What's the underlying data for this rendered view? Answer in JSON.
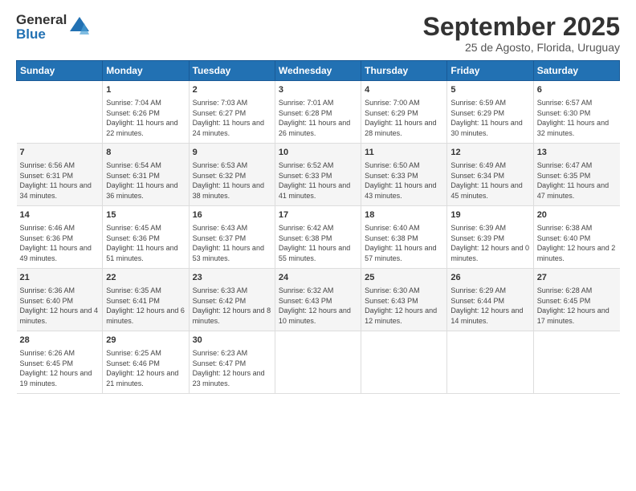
{
  "logo": {
    "line1": "General",
    "line2": "Blue"
  },
  "title": "September 2025",
  "subtitle": "25 de Agosto, Florida, Uruguay",
  "weekdays": [
    "Sunday",
    "Monday",
    "Tuesday",
    "Wednesday",
    "Thursday",
    "Friday",
    "Saturday"
  ],
  "weeks": [
    [
      {
        "day": "",
        "sunrise": "",
        "sunset": "",
        "daylight": ""
      },
      {
        "day": "1",
        "sunrise": "Sunrise: 7:04 AM",
        "sunset": "Sunset: 6:26 PM",
        "daylight": "Daylight: 11 hours and 22 minutes."
      },
      {
        "day": "2",
        "sunrise": "Sunrise: 7:03 AM",
        "sunset": "Sunset: 6:27 PM",
        "daylight": "Daylight: 11 hours and 24 minutes."
      },
      {
        "day": "3",
        "sunrise": "Sunrise: 7:01 AM",
        "sunset": "Sunset: 6:28 PM",
        "daylight": "Daylight: 11 hours and 26 minutes."
      },
      {
        "day": "4",
        "sunrise": "Sunrise: 7:00 AM",
        "sunset": "Sunset: 6:29 PM",
        "daylight": "Daylight: 11 hours and 28 minutes."
      },
      {
        "day": "5",
        "sunrise": "Sunrise: 6:59 AM",
        "sunset": "Sunset: 6:29 PM",
        "daylight": "Daylight: 11 hours and 30 minutes."
      },
      {
        "day": "6",
        "sunrise": "Sunrise: 6:57 AM",
        "sunset": "Sunset: 6:30 PM",
        "daylight": "Daylight: 11 hours and 32 minutes."
      }
    ],
    [
      {
        "day": "7",
        "sunrise": "Sunrise: 6:56 AM",
        "sunset": "Sunset: 6:31 PM",
        "daylight": "Daylight: 11 hours and 34 minutes."
      },
      {
        "day": "8",
        "sunrise": "Sunrise: 6:54 AM",
        "sunset": "Sunset: 6:31 PM",
        "daylight": "Daylight: 11 hours and 36 minutes."
      },
      {
        "day": "9",
        "sunrise": "Sunrise: 6:53 AM",
        "sunset": "Sunset: 6:32 PM",
        "daylight": "Daylight: 11 hours and 38 minutes."
      },
      {
        "day": "10",
        "sunrise": "Sunrise: 6:52 AM",
        "sunset": "Sunset: 6:33 PM",
        "daylight": "Daylight: 11 hours and 41 minutes."
      },
      {
        "day": "11",
        "sunrise": "Sunrise: 6:50 AM",
        "sunset": "Sunset: 6:33 PM",
        "daylight": "Daylight: 11 hours and 43 minutes."
      },
      {
        "day": "12",
        "sunrise": "Sunrise: 6:49 AM",
        "sunset": "Sunset: 6:34 PM",
        "daylight": "Daylight: 11 hours and 45 minutes."
      },
      {
        "day": "13",
        "sunrise": "Sunrise: 6:47 AM",
        "sunset": "Sunset: 6:35 PM",
        "daylight": "Daylight: 11 hours and 47 minutes."
      }
    ],
    [
      {
        "day": "14",
        "sunrise": "Sunrise: 6:46 AM",
        "sunset": "Sunset: 6:36 PM",
        "daylight": "Daylight: 11 hours and 49 minutes."
      },
      {
        "day": "15",
        "sunrise": "Sunrise: 6:45 AM",
        "sunset": "Sunset: 6:36 PM",
        "daylight": "Daylight: 11 hours and 51 minutes."
      },
      {
        "day": "16",
        "sunrise": "Sunrise: 6:43 AM",
        "sunset": "Sunset: 6:37 PM",
        "daylight": "Daylight: 11 hours and 53 minutes."
      },
      {
        "day": "17",
        "sunrise": "Sunrise: 6:42 AM",
        "sunset": "Sunset: 6:38 PM",
        "daylight": "Daylight: 11 hours and 55 minutes."
      },
      {
        "day": "18",
        "sunrise": "Sunrise: 6:40 AM",
        "sunset": "Sunset: 6:38 PM",
        "daylight": "Daylight: 11 hours and 57 minutes."
      },
      {
        "day": "19",
        "sunrise": "Sunrise: 6:39 AM",
        "sunset": "Sunset: 6:39 PM",
        "daylight": "Daylight: 12 hours and 0 minutes."
      },
      {
        "day": "20",
        "sunrise": "Sunrise: 6:38 AM",
        "sunset": "Sunset: 6:40 PM",
        "daylight": "Daylight: 12 hours and 2 minutes."
      }
    ],
    [
      {
        "day": "21",
        "sunrise": "Sunrise: 6:36 AM",
        "sunset": "Sunset: 6:40 PM",
        "daylight": "Daylight: 12 hours and 4 minutes."
      },
      {
        "day": "22",
        "sunrise": "Sunrise: 6:35 AM",
        "sunset": "Sunset: 6:41 PM",
        "daylight": "Daylight: 12 hours and 6 minutes."
      },
      {
        "day": "23",
        "sunrise": "Sunrise: 6:33 AM",
        "sunset": "Sunset: 6:42 PM",
        "daylight": "Daylight: 12 hours and 8 minutes."
      },
      {
        "day": "24",
        "sunrise": "Sunrise: 6:32 AM",
        "sunset": "Sunset: 6:43 PM",
        "daylight": "Daylight: 12 hours and 10 minutes."
      },
      {
        "day": "25",
        "sunrise": "Sunrise: 6:30 AM",
        "sunset": "Sunset: 6:43 PM",
        "daylight": "Daylight: 12 hours and 12 minutes."
      },
      {
        "day": "26",
        "sunrise": "Sunrise: 6:29 AM",
        "sunset": "Sunset: 6:44 PM",
        "daylight": "Daylight: 12 hours and 14 minutes."
      },
      {
        "day": "27",
        "sunrise": "Sunrise: 6:28 AM",
        "sunset": "Sunset: 6:45 PM",
        "daylight": "Daylight: 12 hours and 17 minutes."
      }
    ],
    [
      {
        "day": "28",
        "sunrise": "Sunrise: 6:26 AM",
        "sunset": "Sunset: 6:45 PM",
        "daylight": "Daylight: 12 hours and 19 minutes."
      },
      {
        "day": "29",
        "sunrise": "Sunrise: 6:25 AM",
        "sunset": "Sunset: 6:46 PM",
        "daylight": "Daylight: 12 hours and 21 minutes."
      },
      {
        "day": "30",
        "sunrise": "Sunrise: 6:23 AM",
        "sunset": "Sunset: 6:47 PM",
        "daylight": "Daylight: 12 hours and 23 minutes."
      },
      {
        "day": "",
        "sunrise": "",
        "sunset": "",
        "daylight": ""
      },
      {
        "day": "",
        "sunrise": "",
        "sunset": "",
        "daylight": ""
      },
      {
        "day": "",
        "sunrise": "",
        "sunset": "",
        "daylight": ""
      },
      {
        "day": "",
        "sunrise": "",
        "sunset": "",
        "daylight": ""
      }
    ]
  ]
}
